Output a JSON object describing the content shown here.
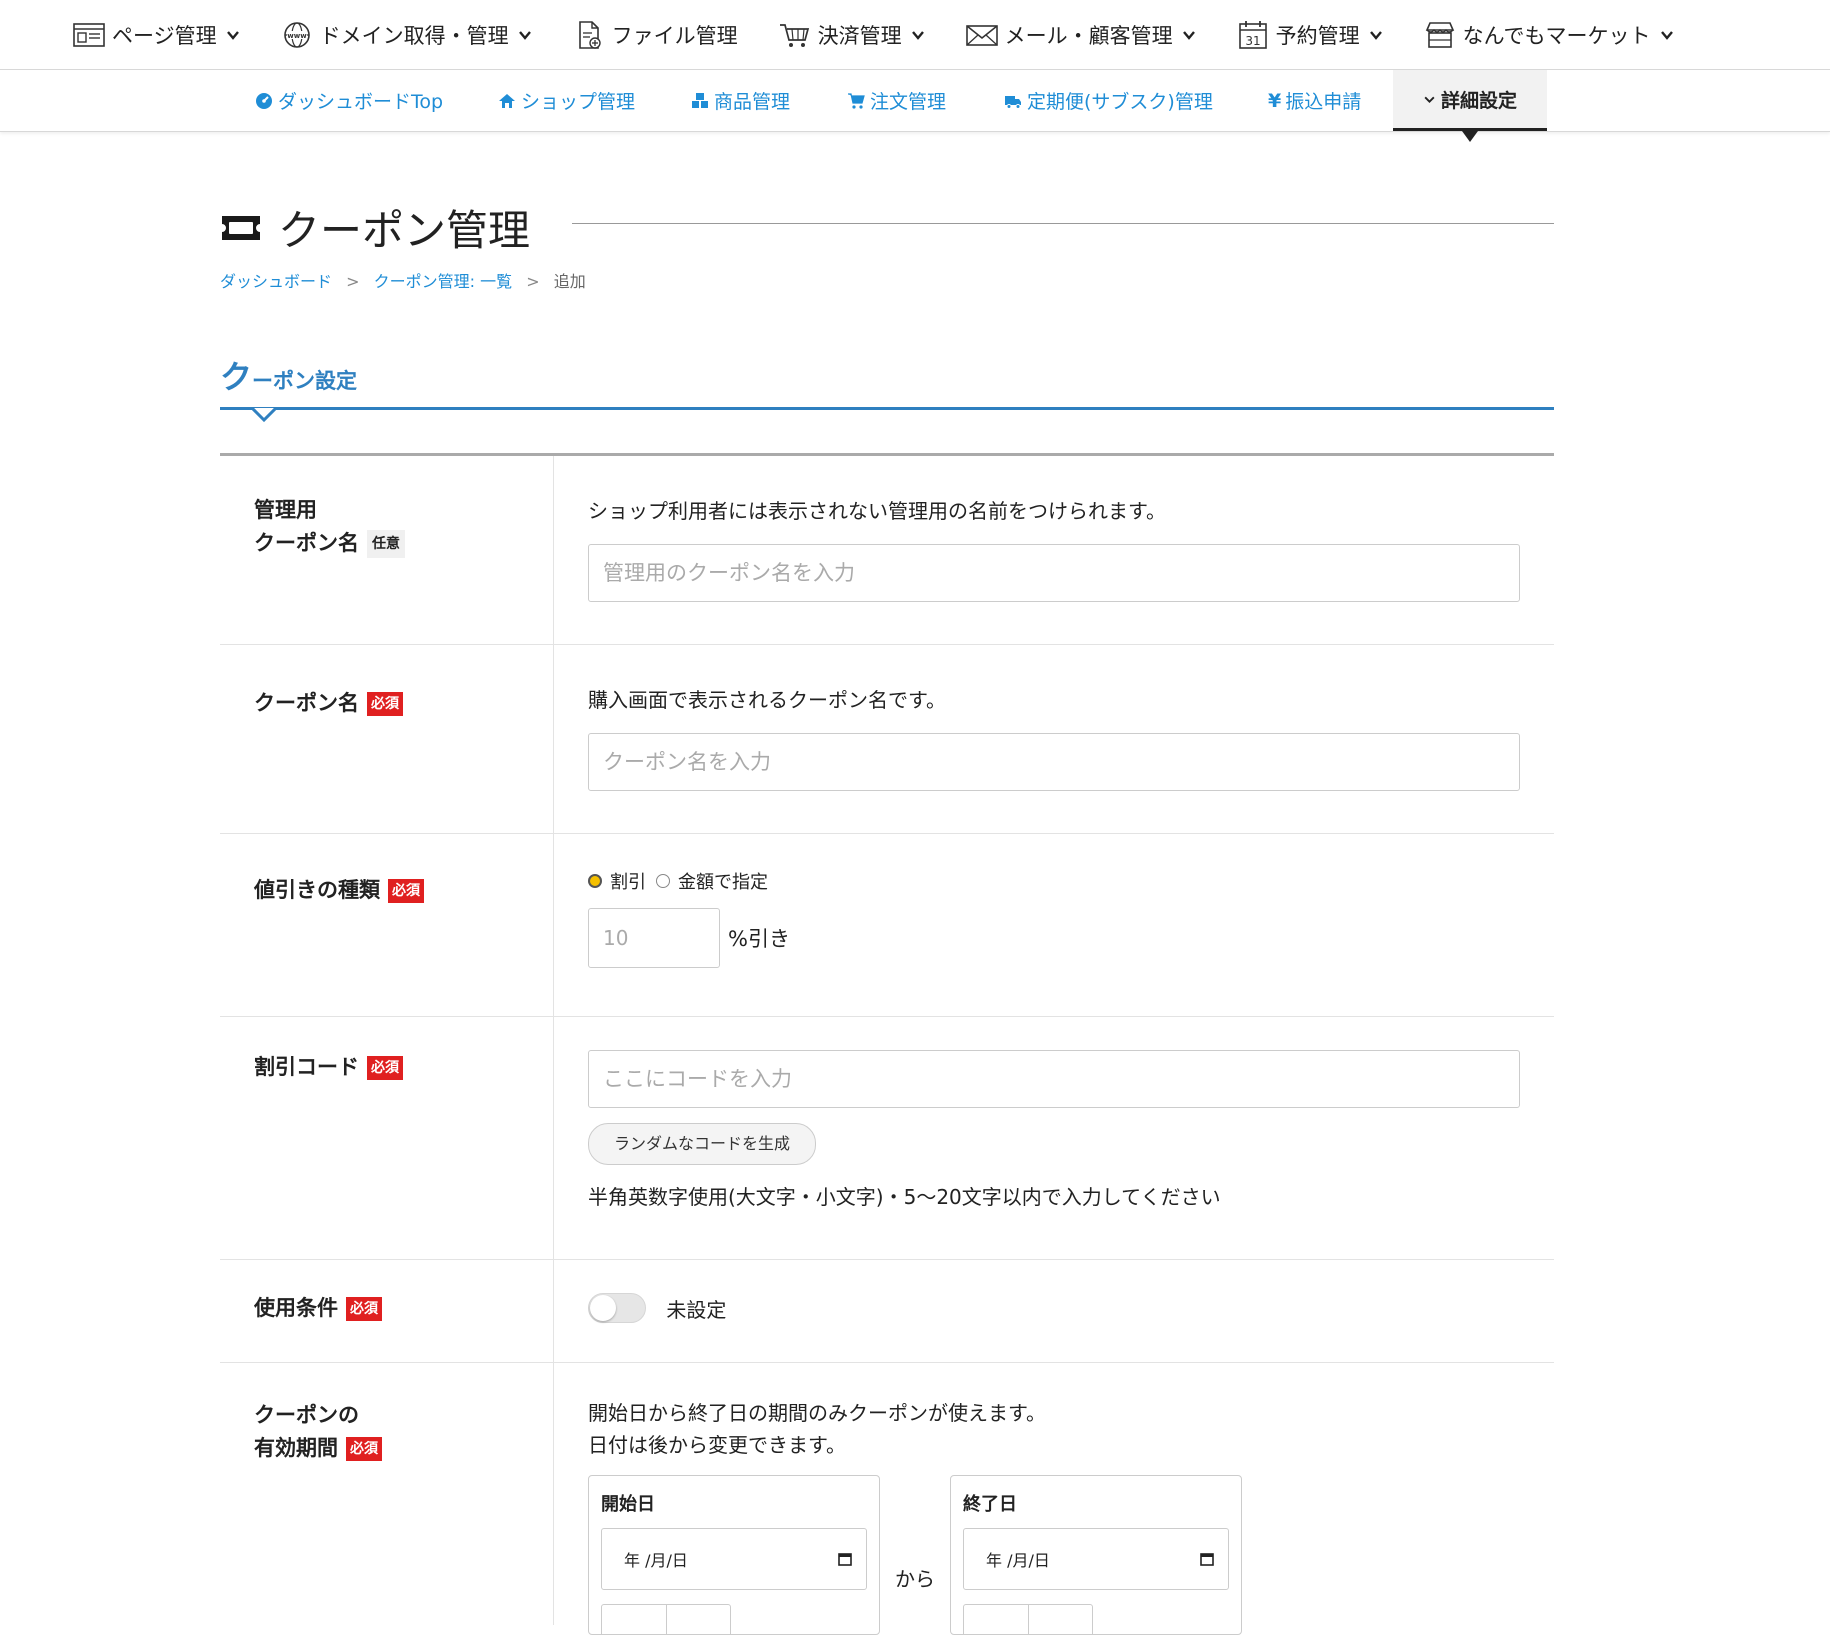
{
  "top_nav": [
    {
      "label": "ページ管理",
      "icon": "page-icon"
    },
    {
      "label": "ドメイン取得・管理",
      "icon": "globe-www-icon"
    },
    {
      "label": "ファイル管理",
      "icon": "file-icon"
    },
    {
      "label": "決済管理",
      "icon": "cart-icon"
    },
    {
      "label": "メール・顧客管理",
      "icon": "mail-icon"
    },
    {
      "label": "予約管理",
      "icon": "calendar-icon",
      "calendar_day": "31"
    },
    {
      "label": "なんでもマーケット",
      "icon": "store-icon"
    }
  ],
  "sub_nav": [
    {
      "label": "ダッシュボードTop",
      "icon": "dashboard-icon"
    },
    {
      "label": "ショップ管理",
      "icon": "home-icon"
    },
    {
      "label": "商品管理",
      "icon": "cubes-icon"
    },
    {
      "label": "注文管理",
      "icon": "cart-icon"
    },
    {
      "label": "定期便(サブスク)管理",
      "icon": "truck-icon"
    },
    {
      "label": "振込申請",
      "icon": "yen-icon"
    },
    {
      "label": "詳細設定",
      "icon": "chevron-down-icon",
      "active": true
    }
  ],
  "page": {
    "title": "クーポン管理",
    "breadcrumb": [
      "ダッシュボード",
      "クーポン管理: 一覧",
      "追加"
    ],
    "breadcrumb_sep": ">",
    "section_title_big": "ク",
    "section_title_small": "ーポン設定"
  },
  "badges": {
    "required": "必須",
    "optional": "任意"
  },
  "form": {
    "admin_name": {
      "label_line1": "管理用",
      "label_line2": "クーポン名",
      "help": "ショップ利用者には表示されない管理用の名前をつけられます。",
      "placeholder": "管理用のクーポン名を入力"
    },
    "coupon_name": {
      "label": "クーポン名",
      "help": "購入画面で表示されるクーポン名です。",
      "placeholder": "クーポン名を入力"
    },
    "discount_type": {
      "label": "値引きの種類",
      "options": [
        "割引",
        "金額で指定"
      ],
      "selected": "割引",
      "value_placeholder": "10",
      "unit": "%引き"
    },
    "discount_code": {
      "label": "割引コード",
      "placeholder": "ここにコードを入力",
      "generate_button": "ランダムなコードを生成",
      "note": "半角英数字使用(大文字・小文字)・5〜20文字以内で入力してください"
    },
    "conditions": {
      "label": "使用条件",
      "toggle_on": false,
      "toggle_text": "未設定"
    },
    "period": {
      "label_line1": "クーポンの",
      "label_line2": "有効期間",
      "help_line1": "開始日から終了日の期間のみクーポンが使えます。",
      "help_line2": "日付は後から変更できます。",
      "start_label": "開始日",
      "end_label": "終了日",
      "date_placeholder": "年 /月/日",
      "between": "から"
    }
  },
  "colors": {
    "accent": "#2f80c0",
    "link": "#1f8dd6",
    "required": "#e02020",
    "radio_selected": "#f5c000"
  }
}
